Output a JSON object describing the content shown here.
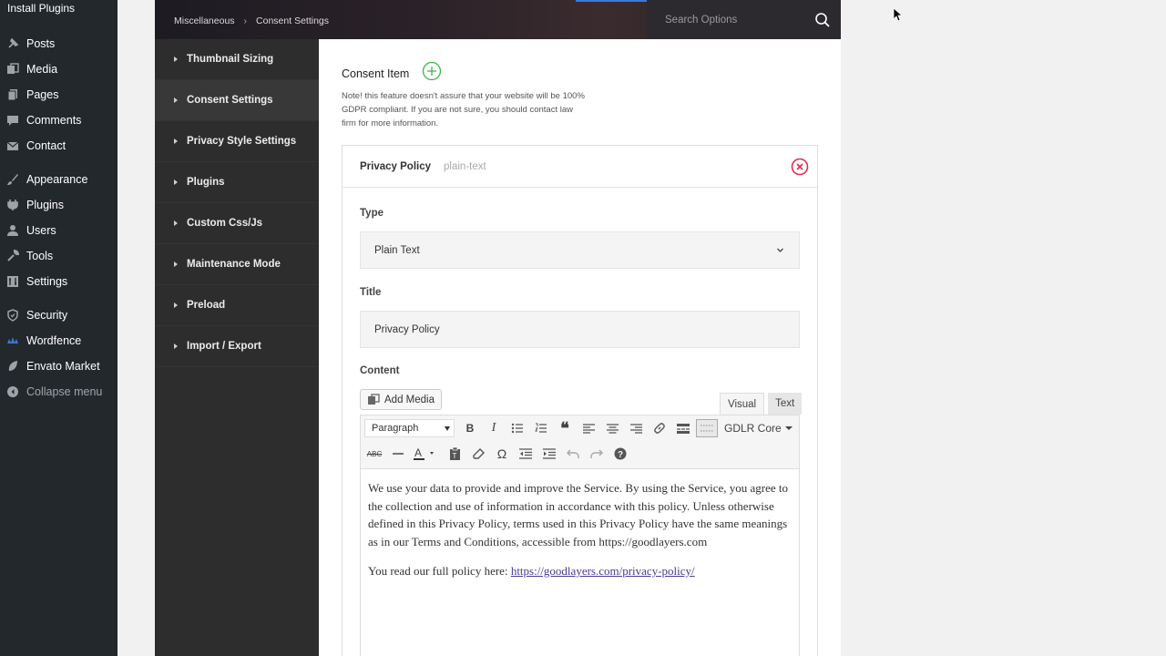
{
  "wp_menu": {
    "top_item": "Install Plugins",
    "items": [
      {
        "label": "Posts",
        "icon": "pin-icon"
      },
      {
        "label": "Media",
        "icon": "media-icon"
      },
      {
        "label": "Pages",
        "icon": "pages-icon"
      },
      {
        "label": "Comments",
        "icon": "comment-icon"
      },
      {
        "label": "Contact",
        "icon": "mail-icon"
      },
      {
        "label": "Appearance",
        "icon": "brush-icon"
      },
      {
        "label": "Plugins",
        "icon": "plugin-icon"
      },
      {
        "label": "Users",
        "icon": "user-icon"
      },
      {
        "label": "Tools",
        "icon": "wrench-icon"
      },
      {
        "label": "Settings",
        "icon": "settings-icon"
      },
      {
        "label": "Security",
        "icon": "shield-icon"
      },
      {
        "label": "Wordfence",
        "icon": "wordfence-icon"
      },
      {
        "label": "Envato Market",
        "icon": "leaf-icon"
      },
      {
        "label": "Collapse menu",
        "icon": "collapse-icon"
      }
    ]
  },
  "header": {
    "breadcrumb": [
      "Miscellaneous",
      "Consent Settings"
    ],
    "breadcrumb_separator": "›",
    "search_placeholder": "Search Options"
  },
  "nav": {
    "items": [
      {
        "label": "Thumbnail Sizing",
        "active": false
      },
      {
        "label": "Consent Settings",
        "active": true
      },
      {
        "label": "Privacy Style Settings",
        "active": false
      },
      {
        "label": "Plugins",
        "active": false
      },
      {
        "label": "Custom Css/Js",
        "active": false
      },
      {
        "label": "Maintenance Mode",
        "active": false
      },
      {
        "label": "Preload",
        "active": false
      },
      {
        "label": "Import / Export",
        "active": false
      }
    ]
  },
  "content": {
    "section_label": "Consent Item",
    "note": "Note! this feature doesn't assure that your website will be 100% GDPR compliant. If you are not sure, you should contact law firm for more information.",
    "item": {
      "title": "Privacy Policy",
      "type_tag": "plain-text",
      "type_label": "Type",
      "type_value": "Plain Text",
      "title_label": "Title",
      "title_value": "Privacy Policy",
      "content_label": "Content",
      "add_media_label": "Add Media",
      "tab_visual": "Visual",
      "tab_text": "Text",
      "format_value": "Paragraph",
      "gdlr_core_label": "GDLR Core",
      "paragraph_1": "We use your data to provide and improve the Service. By using the Service, you agree to the collection and use of information in accordance with this policy. Unless otherwise defined in this Privacy Policy, terms used in this Privacy Policy have the same meanings as in our Terms and Conditions, accessible from https://goodlayers.com",
      "paragraph_2_prefix": "You read our full policy here: ",
      "policy_link": "https://goodlayers.com/privacy-policy/"
    }
  },
  "colors": {
    "wp_sidebar": "#23282d",
    "panel_nav": "#2d2d2d",
    "add_green": "#3bb54a",
    "remove_red": "#e0304a",
    "link_purple": "#4b3a94"
  }
}
